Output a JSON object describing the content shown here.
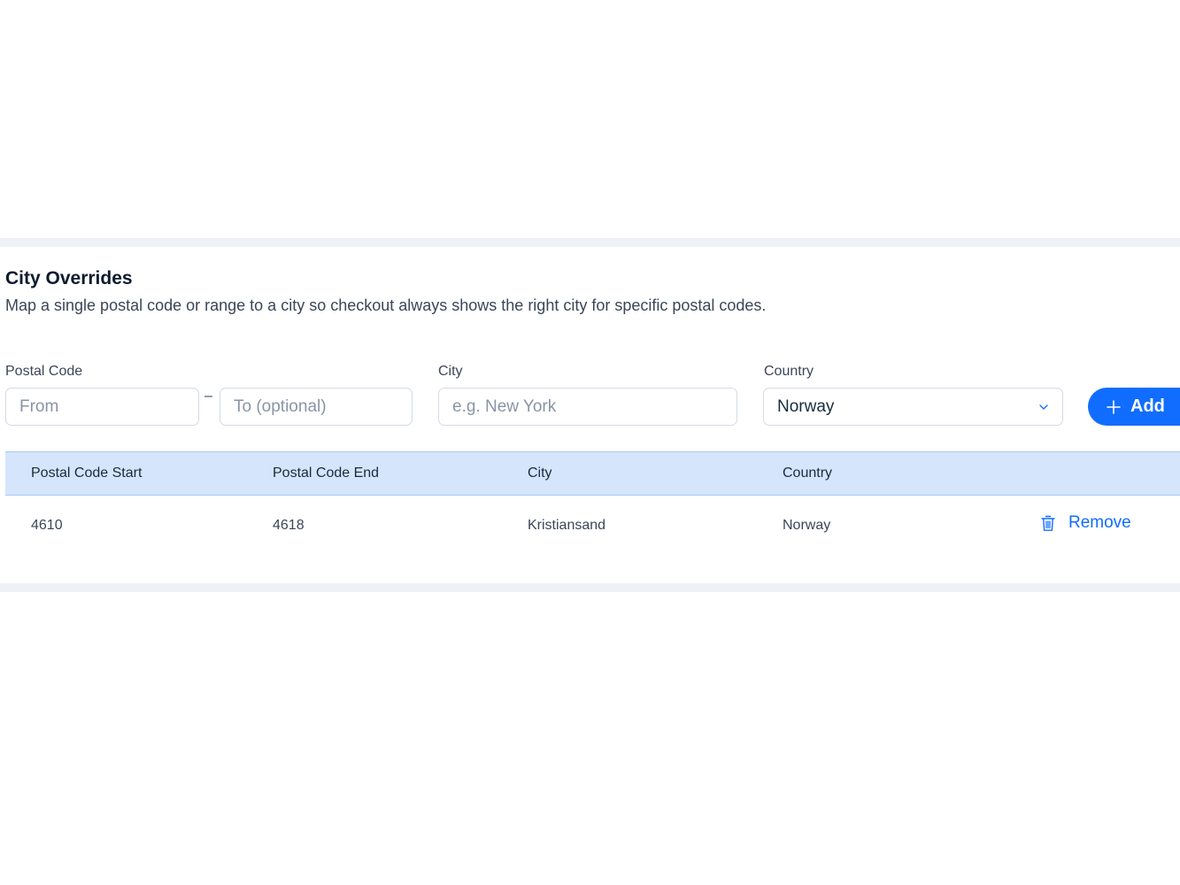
{
  "section": {
    "title": "City Overrides",
    "description": "Map a single postal code or range to a city so checkout always shows the right city for specific postal codes."
  },
  "form": {
    "postal_code_label": "Postal Code",
    "from_placeholder": "From",
    "from_value": "",
    "range_separator": "–",
    "to_placeholder": "To (optional)",
    "to_value": "",
    "city_label": "City",
    "city_placeholder": "e.g. New York",
    "city_value": "",
    "country_label": "Country",
    "country_selected": "Norway",
    "add_button_label": "Add"
  },
  "table": {
    "columns": [
      "Postal Code Start",
      "Postal Code End",
      "City",
      "Country"
    ],
    "rows": [
      {
        "postal_code_start": "4610",
        "postal_code_end": "4618",
        "city": "Kristiansand",
        "country": "Norway",
        "action_label": "Remove"
      }
    ]
  },
  "icons": {
    "add": "plus-icon",
    "select": "chevron-down-icon",
    "remove": "trash-icon"
  },
  "colors": {
    "accent": "#116dff",
    "header_bg": "#d5e5fc",
    "divider": "#eef1f6"
  }
}
